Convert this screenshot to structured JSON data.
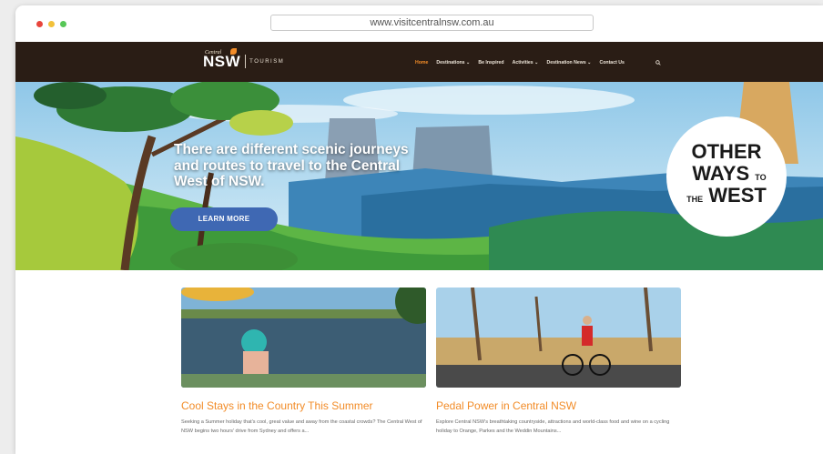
{
  "browser": {
    "url": "www.visitcentralnsw.com.au"
  },
  "logo": {
    "small": "Central",
    "main": "NSW",
    "sub": "TOURISM"
  },
  "menu": {
    "items": [
      "Home",
      "Destinations ⌄",
      "Be Inspired",
      "Activities ⌄",
      "Destination News ⌄",
      "Contact Us"
    ]
  },
  "hero": {
    "headline": "There are different scenic journeys and routes to travel to the Central West of NSW.",
    "button": "LEARN MORE",
    "badge": {
      "line1": "OTHER",
      "line2": "WAYS",
      "line3": "TO",
      "line4": "THE",
      "line5": "WEST"
    }
  },
  "cards": [
    {
      "title": "Cool Stays in the Country This Summer",
      "desc": "Seeking a Summer holiday that's cool, great value and away from the coastal crowds? The Central West of NSW begins two hours' drive from Sydney and offers a..."
    },
    {
      "title": "Pedal Power in Central NSW",
      "desc": "Explore Central NSW's breathtaking countryside, attractions and world-class food and wine on a cycling holiday to Orange, Parkes and the Weddin Mountains..."
    }
  ],
  "colors": {
    "nav_bg": "#2a1d15",
    "accent": "#f28c28",
    "button": "#3f68b3"
  }
}
